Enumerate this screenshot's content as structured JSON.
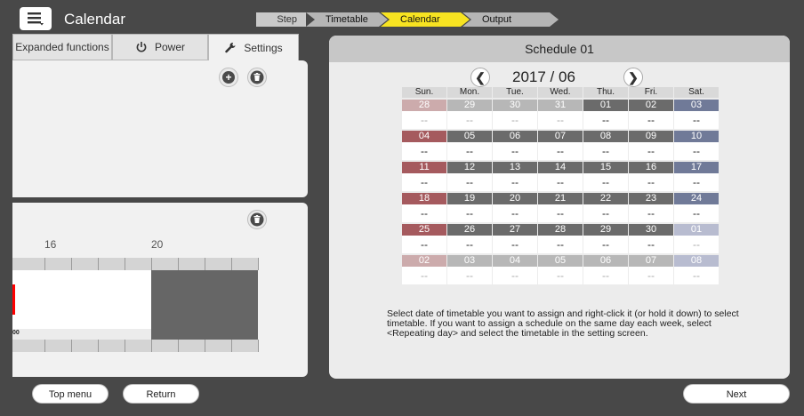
{
  "header": {
    "title": "Calendar",
    "menu_icon": "menu-icon"
  },
  "steps": {
    "label": "Step",
    "items": [
      "Timetable",
      "Calendar",
      "Output"
    ],
    "active": "Calendar",
    "active_color": "#f7e321"
  },
  "left": {
    "tabs": [
      {
        "label": "Expanded functions",
        "icon": ""
      },
      {
        "label": "Power",
        "icon": "power-icon"
      },
      {
        "label": "Settings",
        "icon": "wrench-icon"
      }
    ],
    "add_icon": "plus-circle-icon",
    "delete_icon": "trash-icon",
    "timeline": {
      "hour_labels": [
        "16",
        "20"
      ],
      "time_label": "00",
      "bar_color": "#ff0000",
      "off_color": "#666666"
    }
  },
  "schedule": {
    "title": "Schedule 01",
    "month": "2017 / 06",
    "weekdays": [
      "Sun.",
      "Mon.",
      "Tue.",
      "Wed.",
      "Thu.",
      "Fri.",
      "Sat."
    ],
    "colors": {
      "sunday": "#a55a5e",
      "weekday": "#6b6b6b",
      "saturday": "#707a98",
      "sunday_dim": "#ccabac",
      "weekday_dim": "#b7b7b7",
      "saturday_dim": "#b8bcd0"
    },
    "weeks": [
      [
        {
          "d": "28",
          "v": "--",
          "o": true
        },
        {
          "d": "29",
          "v": "--",
          "o": true
        },
        {
          "d": "30",
          "v": "--",
          "o": true
        },
        {
          "d": "31",
          "v": "--",
          "o": true
        },
        {
          "d": "01",
          "v": "--",
          "o": false
        },
        {
          "d": "02",
          "v": "--",
          "o": false
        },
        {
          "d": "03",
          "v": "--",
          "o": false
        }
      ],
      [
        {
          "d": "04",
          "v": "--",
          "o": false
        },
        {
          "d": "05",
          "v": "--",
          "o": false
        },
        {
          "d": "06",
          "v": "--",
          "o": false
        },
        {
          "d": "07",
          "v": "--",
          "o": false
        },
        {
          "d": "08",
          "v": "--",
          "o": false
        },
        {
          "d": "09",
          "v": "--",
          "o": false
        },
        {
          "d": "10",
          "v": "--",
          "o": false
        }
      ],
      [
        {
          "d": "11",
          "v": "--",
          "o": false
        },
        {
          "d": "12",
          "v": "--",
          "o": false
        },
        {
          "d": "13",
          "v": "--",
          "o": false
        },
        {
          "d": "14",
          "v": "--",
          "o": false
        },
        {
          "d": "15",
          "v": "--",
          "o": false
        },
        {
          "d": "16",
          "v": "--",
          "o": false
        },
        {
          "d": "17",
          "v": "--",
          "o": false
        }
      ],
      [
        {
          "d": "18",
          "v": "--",
          "o": false
        },
        {
          "d": "19",
          "v": "--",
          "o": false
        },
        {
          "d": "20",
          "v": "--",
          "o": false
        },
        {
          "d": "21",
          "v": "--",
          "o": false
        },
        {
          "d": "22",
          "v": "--",
          "o": false
        },
        {
          "d": "23",
          "v": "--",
          "o": false
        },
        {
          "d": "24",
          "v": "--",
          "o": false
        }
      ],
      [
        {
          "d": "25",
          "v": "--",
          "o": false
        },
        {
          "d": "26",
          "v": "--",
          "o": false
        },
        {
          "d": "27",
          "v": "--",
          "o": false
        },
        {
          "d": "28",
          "v": "--",
          "o": false
        },
        {
          "d": "29",
          "v": "--",
          "o": false
        },
        {
          "d": "30",
          "v": "--",
          "o": false
        },
        {
          "d": "01",
          "v": "--",
          "o": true
        }
      ],
      [
        {
          "d": "02",
          "v": "--",
          "o": true
        },
        {
          "d": "03",
          "v": "--",
          "o": true
        },
        {
          "d": "04",
          "v": "--",
          "o": true
        },
        {
          "d": "05",
          "v": "--",
          "o": true
        },
        {
          "d": "06",
          "v": "--",
          "o": true
        },
        {
          "d": "07",
          "v": "--",
          "o": true
        },
        {
          "d": "08",
          "v": "--",
          "o": true
        }
      ]
    ],
    "note": "Select date of timetable you want to assign and right-click it (or hold it down) to select timetable. If you want to assign a schedule on the same day each week, select <Repeating day> and select the timetable in the setting screen.",
    "prev_icon": "chevron-left-icon",
    "next_icon": "chevron-right-icon"
  },
  "footer": {
    "top_menu": "Top menu",
    "return": "Return",
    "next": "Next"
  }
}
